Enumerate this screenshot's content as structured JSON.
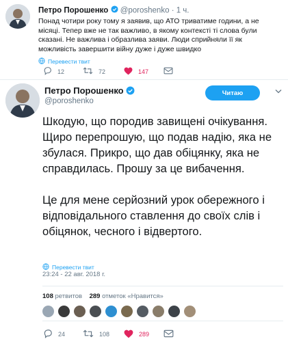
{
  "quoted": {
    "name": "Петро Порошенко",
    "handle": "@poroshenko",
    "time": "· 1 ч.",
    "text": "Понад чотири року тому я заявив, що АТО триватиме години, а не місяці. Тепер вже не так важливо, в якому контексті ті слова були сказані. Не важлива і образлива заяви. Люди сприйняли її як можливість завершити війну дуже і дуже швидко",
    "translate": "Перевести твит",
    "reply_count": "12",
    "retweet_count": "72",
    "like_count": "147"
  },
  "tweet": {
    "name": "Петро Порошенко",
    "handle": "@poroshenko",
    "follow_label": "Читаю",
    "paragraph1": "Шкодую, що породив завищені очікування. Щиро перепрошую, що подав надію, яка не збулася. Прикро, що дав обіцянку, яка не справдилась. Прошу за це вибачення.",
    "paragraph2": "Це для мене серйозний урок обережного і відповідального ставлення до своїх слів і обіцянок, чесного і відвертого.",
    "translate": "Перевести твит",
    "timestamp": "23:24 - 22 авг. 2018 г.",
    "retweets": "108",
    "retweets_label": "ретвитов",
    "likes": "289",
    "likes_label": "отметок «Нравится»",
    "reply_count": "24",
    "retweet_count": "108",
    "like_count": "289"
  },
  "colors": {
    "accent": "#1da1f2",
    "like": "#e0245e",
    "muted": "#657786"
  },
  "icons": {
    "verified": "verified-badge-icon",
    "reply": "reply-icon",
    "retweet": "retweet-icon",
    "like": "heart-icon",
    "dm": "envelope-icon",
    "caret": "chevron-down-icon",
    "globe": "globe-icon"
  }
}
